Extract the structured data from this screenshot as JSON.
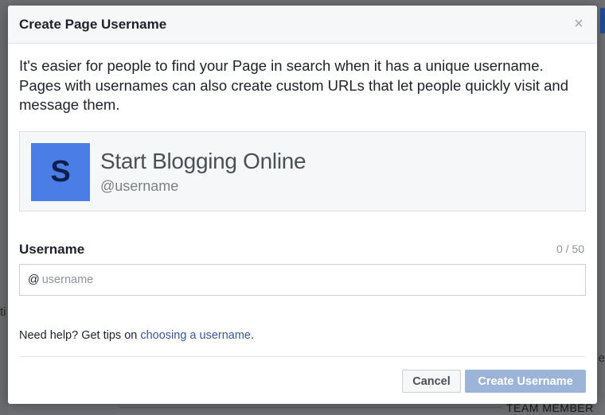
{
  "dialog": {
    "title": "Create Page Username",
    "close_symbol": "×",
    "intro": "It's easier for people to find your Page in search when it has a unique username. Pages with usernames can also create custom URLs that let people quickly visit and message them.",
    "preview": {
      "avatar_letter": "S",
      "page_name": "Start Blogging Online",
      "handle": "@username"
    },
    "field": {
      "label": "Username",
      "count": "0 / 50",
      "prefix": "@",
      "value": "",
      "placeholder": "username"
    },
    "help": {
      "text": "Need help? Get tips on ",
      "link": "choosing a username",
      "suffix": "."
    },
    "buttons": {
      "cancel": "Cancel",
      "create": "Create Username"
    }
  },
  "background": {
    "left_fragment": "ti",
    "right_fragment": "e",
    "team_label": "TEAM MEMBER"
  },
  "colors": {
    "accent_link": "#365899",
    "avatar_bg": "#4a7ee6",
    "create_button_disabled": "#9cb4d8"
  },
  "icons": {
    "close": "close-icon"
  }
}
